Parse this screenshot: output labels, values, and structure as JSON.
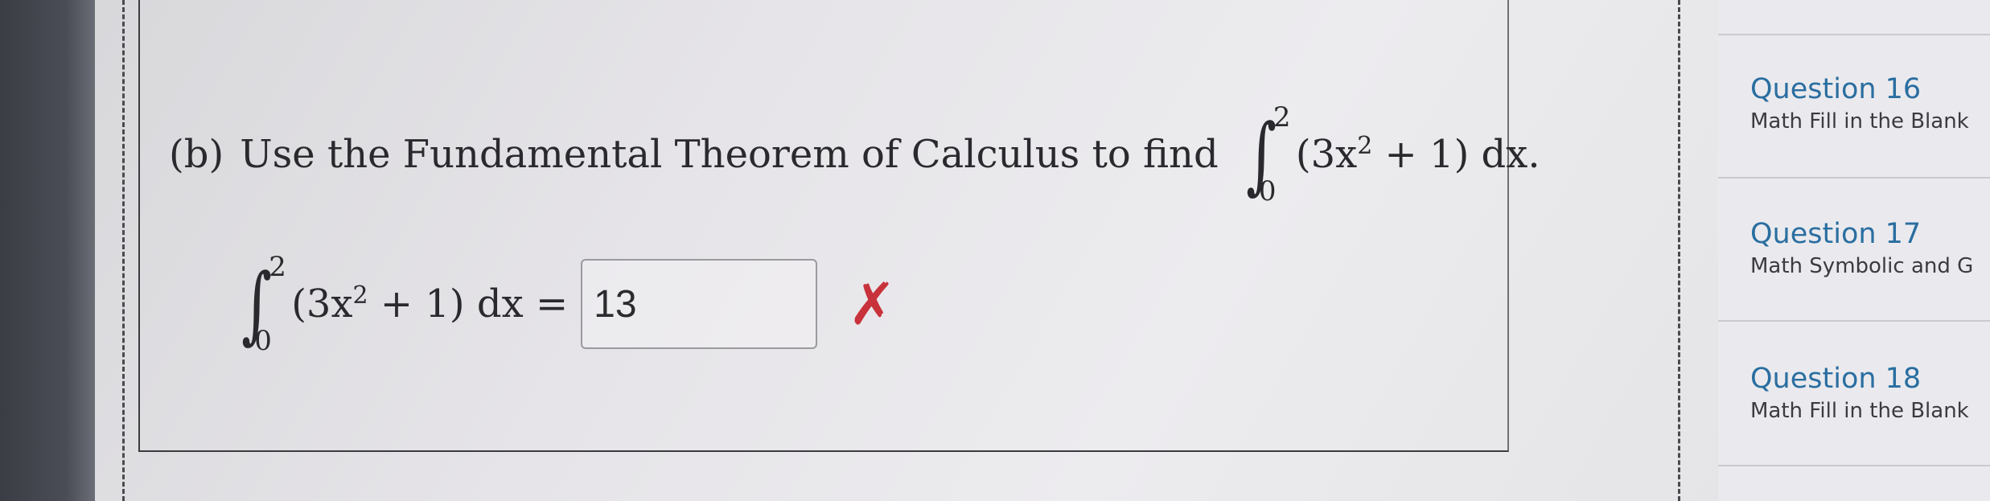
{
  "question": {
    "part_label": "(b)",
    "prompt": "Use the Fundamental Theorem of Calculus to find",
    "integral": {
      "sign": "∫",
      "upper_limit": "2",
      "lower_limit": "0",
      "integrand_prefix": "(3x",
      "exponent": "2",
      "integrand_suffix": " + 1) dx."
    }
  },
  "answer": {
    "integral_sign": "∫",
    "upper_limit": "2",
    "lower_limit": "0",
    "integrand_prefix": "(3x",
    "exponent": "2",
    "integrand_suffix": " + 1) dx =",
    "value": "13",
    "status_icon": "✗",
    "status": "incorrect",
    "status_color": "#c8323a"
  },
  "sidebar": {
    "items": [
      {
        "title": "Question 16",
        "type": "Math Fill in the Blank"
      },
      {
        "title": "Question 17",
        "type": "Math Symbolic and G"
      },
      {
        "title": "Question 18",
        "type": "Math Fill in the Blank"
      }
    ]
  },
  "colors": {
    "link": "#2a6ea0",
    "text": "#2a2a2e"
  }
}
